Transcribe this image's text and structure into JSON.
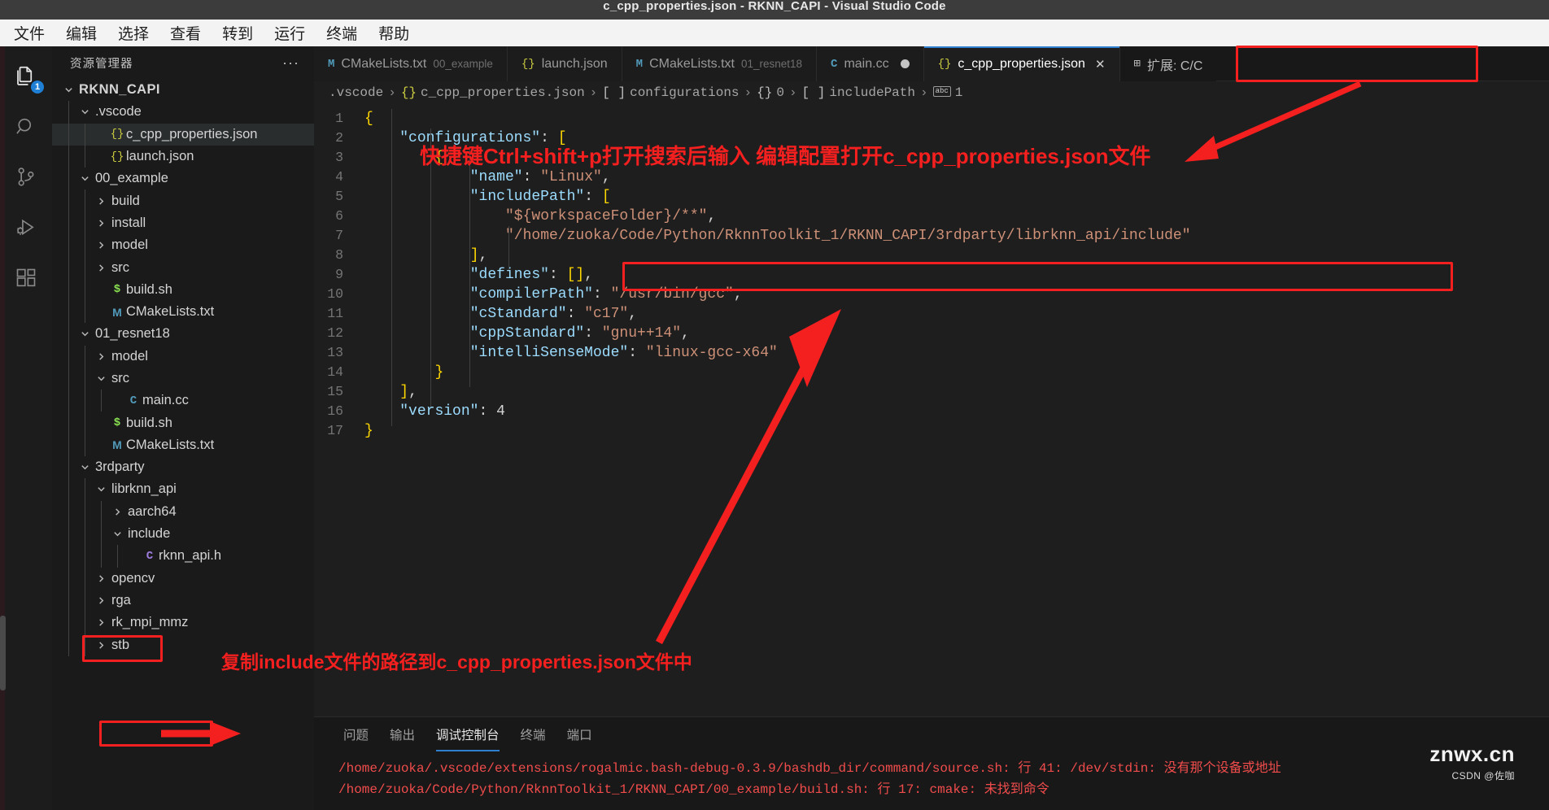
{
  "window": {
    "title": "c_cpp_properties.json - RKNN_CAPI - Visual Studio Code"
  },
  "menubar": {
    "items": [
      "文件",
      "编辑",
      "选择",
      "查看",
      "转到",
      "运行",
      "终端",
      "帮助"
    ]
  },
  "activitybar": {
    "items": [
      {
        "name": "explorer",
        "icon": "files-icon",
        "badge": "1",
        "active": true
      },
      {
        "name": "search",
        "icon": "search-icon",
        "badge": "",
        "active": false
      },
      {
        "name": "source-control",
        "icon": "source-control-icon",
        "badge": "",
        "active": false
      },
      {
        "name": "run-debug",
        "icon": "run-debug-icon",
        "badge": "",
        "active": false
      },
      {
        "name": "extensions",
        "icon": "extensions-icon",
        "badge": "",
        "active": false
      }
    ]
  },
  "sidebar": {
    "title": "资源管理器",
    "more": "···",
    "tree": [
      {
        "label": "RKNN_CAPI",
        "indent": 0,
        "chev": "down",
        "icon": "",
        "bold": true,
        "selected": false
      },
      {
        "label": ".vscode",
        "indent": 1,
        "chev": "down",
        "icon": "",
        "bold": false,
        "selected": false
      },
      {
        "label": "c_cpp_properties.json",
        "indent": 2,
        "chev": "none",
        "icon": "json",
        "bold": false,
        "selected": true
      },
      {
        "label": "launch.json",
        "indent": 2,
        "chev": "none",
        "icon": "json",
        "bold": false,
        "selected": false
      },
      {
        "label": "00_example",
        "indent": 1,
        "chev": "down",
        "icon": "",
        "bold": false,
        "selected": false
      },
      {
        "label": "build",
        "indent": 2,
        "chev": "right",
        "icon": "",
        "bold": false,
        "selected": false
      },
      {
        "label": "install",
        "indent": 2,
        "chev": "right",
        "icon": "",
        "bold": false,
        "selected": false
      },
      {
        "label": "model",
        "indent": 2,
        "chev": "right",
        "icon": "",
        "bold": false,
        "selected": false
      },
      {
        "label": "src",
        "indent": 2,
        "chev": "right",
        "icon": "",
        "bold": false,
        "selected": false
      },
      {
        "label": "build.sh",
        "indent": 2,
        "chev": "none",
        "icon": "sh",
        "bold": false,
        "selected": false
      },
      {
        "label": "CMakeLists.txt",
        "indent": 2,
        "chev": "none",
        "icon": "md",
        "bold": false,
        "selected": false
      },
      {
        "label": "01_resnet18",
        "indent": 1,
        "chev": "down",
        "icon": "",
        "bold": false,
        "selected": false
      },
      {
        "label": "model",
        "indent": 2,
        "chev": "right",
        "icon": "",
        "bold": false,
        "selected": false
      },
      {
        "label": "src",
        "indent": 2,
        "chev": "down",
        "icon": "",
        "bold": false,
        "selected": false
      },
      {
        "label": "main.cc",
        "indent": 3,
        "chev": "none",
        "icon": "cpp",
        "bold": false,
        "selected": false
      },
      {
        "label": "build.sh",
        "indent": 2,
        "chev": "none",
        "icon": "sh",
        "bold": false,
        "selected": false
      },
      {
        "label": "CMakeLists.txt",
        "indent": 2,
        "chev": "none",
        "icon": "md",
        "bold": false,
        "selected": false
      },
      {
        "label": "3rdparty",
        "indent": 1,
        "chev": "down",
        "icon": "",
        "bold": false,
        "selected": false
      },
      {
        "label": "librknn_api",
        "indent": 2,
        "chev": "down",
        "icon": "",
        "bold": false,
        "selected": false
      },
      {
        "label": "aarch64",
        "indent": 3,
        "chev": "right",
        "icon": "",
        "bold": false,
        "selected": false
      },
      {
        "label": "include",
        "indent": 3,
        "chev": "down",
        "icon": "",
        "bold": false,
        "selected": false
      },
      {
        "label": "rknn_api.h",
        "indent": 4,
        "chev": "none",
        "icon": "c",
        "bold": false,
        "selected": false
      },
      {
        "label": "opencv",
        "indent": 2,
        "chev": "right",
        "icon": "",
        "bold": false,
        "selected": false
      },
      {
        "label": "rga",
        "indent": 2,
        "chev": "right",
        "icon": "",
        "bold": false,
        "selected": false
      },
      {
        "label": "rk_mpi_mmz",
        "indent": 2,
        "chev": "right",
        "icon": "",
        "bold": false,
        "selected": false
      },
      {
        "label": "stb",
        "indent": 2,
        "chev": "right",
        "icon": "",
        "bold": false,
        "selected": false
      }
    ]
  },
  "tabs": [
    {
      "label": "CMakeLists.txt",
      "desc": "00_example",
      "icon": "md",
      "active": false,
      "dirty": false,
      "close": false
    },
    {
      "label": "launch.json",
      "desc": "",
      "icon": "json",
      "active": false,
      "dirty": false,
      "close": false
    },
    {
      "label": "CMakeLists.txt",
      "desc": "01_resnet18",
      "icon": "md",
      "active": false,
      "dirty": false,
      "close": false
    },
    {
      "label": "main.cc",
      "desc": "",
      "icon": "cpp",
      "active": false,
      "dirty": true,
      "close": false
    },
    {
      "label": "c_cpp_properties.json",
      "desc": "",
      "icon": "json",
      "active": true,
      "dirty": false,
      "close": true
    },
    {
      "label": "扩展: C/C",
      "desc": "",
      "icon": "ext",
      "active": false,
      "dirty": false,
      "close": false
    }
  ],
  "breadcrumb": {
    "items": [
      ".vscode",
      "c_cpp_properties.json",
      "configurations",
      "0",
      "includePath",
      "1"
    ],
    "separator": "›"
  },
  "code": {
    "lines": [
      {
        "n": "1",
        "text": "{"
      },
      {
        "n": "2",
        "text": "    \"configurations\": ["
      },
      {
        "n": "3",
        "text": "        {"
      },
      {
        "n": "4",
        "text": "            \"name\": \"Linux\","
      },
      {
        "n": "5",
        "text": "            \"includePath\": ["
      },
      {
        "n": "6",
        "text": "                \"${workspaceFolder}/**\","
      },
      {
        "n": "7",
        "text": "                \"/home/zuoka/Code/Python/RknnToolkit_1/RKNN_CAPI/3rdparty/librknn_api/include\""
      },
      {
        "n": "8",
        "text": "            ],"
      },
      {
        "n": "9",
        "text": "            \"defines\": [],"
      },
      {
        "n": "10",
        "text": "            \"compilerPath\": \"/usr/bin/gcc\","
      },
      {
        "n": "11",
        "text": "            \"cStandard\": \"c17\","
      },
      {
        "n": "12",
        "text": "            \"cppStandard\": \"gnu++14\","
      },
      {
        "n": "13",
        "text": "            \"intelliSenseMode\": \"linux-gcc-x64\""
      },
      {
        "n": "14",
        "text": "        }"
      },
      {
        "n": "15",
        "text": "    ],"
      },
      {
        "n": "16",
        "text": "    \"version\": 4"
      },
      {
        "n": "17",
        "text": "}"
      }
    ]
  },
  "panel": {
    "tabs": [
      "问题",
      "输出",
      "调试控制台",
      "终端",
      "端口"
    ],
    "active_tab": "调试控制台",
    "lines": [
      "/home/zuoka/.vscode/extensions/rogalmic.bash-debug-0.3.9/bashdb_dir/command/source.sh: 行 41: /dev/stdin: 没有那个设备或地址",
      "/home/zuoka/Code/Python/RknnToolkit_1/RKNN_CAPI/00_example/build.sh: 行 17: cmake: 未找到命令"
    ]
  },
  "annotations": {
    "top": "快捷键Ctrl+shift+p打开搜索后输入 编辑配置打开c_cpp_properties.json文件",
    "bottom": "复制include文件的路径到c_cpp_properties.json文件中",
    "accent_color": "#f41f1f"
  },
  "watermark": {
    "text": "znwx.cn",
    "sub": "CSDN @佐咖"
  }
}
